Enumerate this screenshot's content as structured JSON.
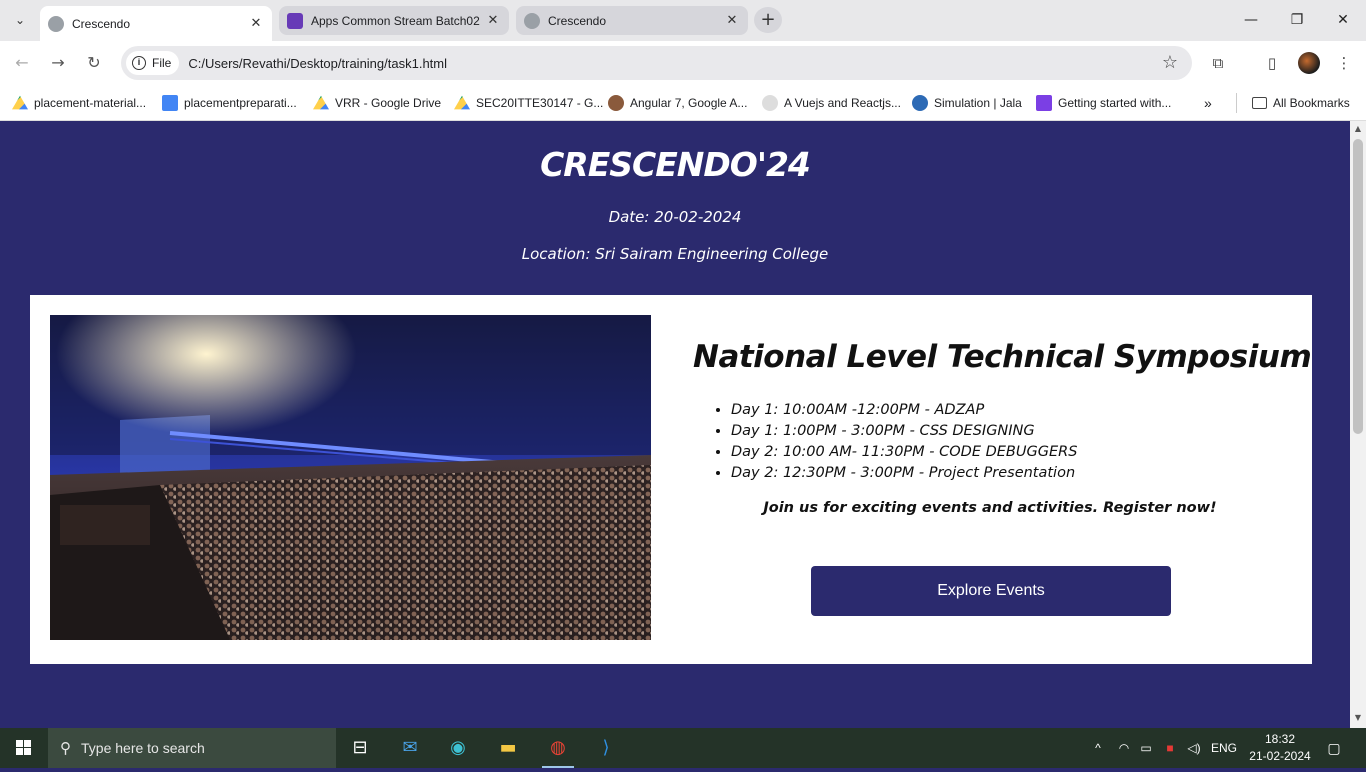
{
  "browser": {
    "tabs": [
      {
        "title": "Crescendo",
        "active": true
      },
      {
        "title": "Apps Common Stream Batch02",
        "active": false
      },
      {
        "title": "Crescendo",
        "active": false
      }
    ],
    "address": {
      "scheme_chip": "File",
      "url": "C:/Users/Revathi/Desktop/training/task1.html"
    },
    "bookmarks": [
      "placement-material...",
      "placementpreparati...",
      "VRR - Google Drive",
      "SEC20ITTE30147 - G...",
      "Angular 7, Google A...",
      "A Vuejs and Reactjs...",
      "Simulation | Jala",
      "Getting started with..."
    ],
    "all_bookmarks_label": "All Bookmarks",
    "more_bookmarks": "»"
  },
  "hero": {
    "title": "CRESCENDO'24",
    "date": "Date: 20-02-2024",
    "location": "Location: Sri Sairam Engineering College"
  },
  "event": {
    "title": "National Level Technical Symposium",
    "schedule": [
      "Day 1: 10:00AM -12:00PM - ADZAP",
      "Day 1: 1:00PM - 3:00PM - CSS DESIGNING",
      "Day 2: 10:00 AM- 11:30PM - CODE DEBUGGERS",
      "Day 2: 12:30PM - 3:00PM - Project Presentation"
    ],
    "cta_text": "Join us for exciting events and activities. Register now!",
    "button_label": "Explore Events"
  },
  "taskbar": {
    "search_placeholder": "Type here to search",
    "language": "ENG",
    "time": "18:32",
    "date": "21-02-2024"
  },
  "colors": {
    "page_background": "#2b2a6e",
    "card_background": "#ffffff",
    "button_background": "#2b2a6e"
  }
}
